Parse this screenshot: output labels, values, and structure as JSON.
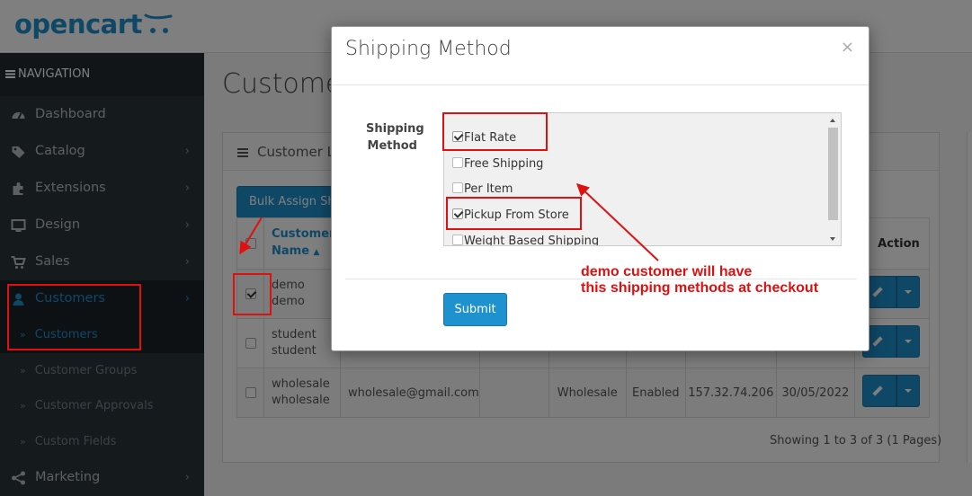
{
  "app": {
    "logo": "opencart"
  },
  "sidebar": {
    "nav_header": "NAVIGATION",
    "items": [
      {
        "label": "Dashboard",
        "icon": "dashboard-icon"
      },
      {
        "label": "Catalog",
        "icon": "tag-icon"
      },
      {
        "label": "Extensions",
        "icon": "puzzle-icon"
      },
      {
        "label": "Design",
        "icon": "monitor-icon"
      },
      {
        "label": "Sales",
        "icon": "cart-icon"
      },
      {
        "label": "Customers",
        "icon": "user-icon"
      }
    ],
    "submenu": [
      "Customers",
      "Customer Groups",
      "Customer Approvals",
      "Custom Fields"
    ],
    "last_item": {
      "label": "Marketing",
      "icon": "share-icon"
    }
  },
  "page": {
    "title": "Customers",
    "panel_title": "Customer List",
    "bulk_button": "Bulk Assign Shipping",
    "table": {
      "col_name": "Customer Name",
      "col_action": "Action",
      "rows": [
        {
          "name1": "demo",
          "name2": "demo",
          "checked": true
        },
        {
          "name1": "student",
          "name2": "student",
          "checked": false
        },
        {
          "name1": "wholesale",
          "name2": "wholesale",
          "checked": false,
          "email": "wholesale@gmail.com",
          "group": "Wholesale",
          "status": "Enabled",
          "ip": "157.32.74.206",
          "date": "30/05/2022"
        }
      ]
    },
    "pagination_text": "Showing 1 to 3 of 3 (1 Pages)"
  },
  "modal": {
    "title": "Shipping Method",
    "close": "×",
    "field_label": "Shipping Method",
    "options": [
      {
        "label": "Flat Rate",
        "checked": true
      },
      {
        "label": "Free Shipping",
        "checked": false
      },
      {
        "label": "Per Item",
        "checked": false
      },
      {
        "label": "Pickup From Store",
        "checked": true
      },
      {
        "label": "Weight Based Shipping",
        "checked": false
      }
    ],
    "submit": "Submit"
  },
  "annotation": {
    "line1": "demo customer will have",
    "line2": "this shipping methods at checkout",
    "color": "#e01010"
  },
  "colors": {
    "primary": "#1e91cf",
    "sidebar_bg": "#2b3439",
    "annotation_red": "#e01010"
  }
}
